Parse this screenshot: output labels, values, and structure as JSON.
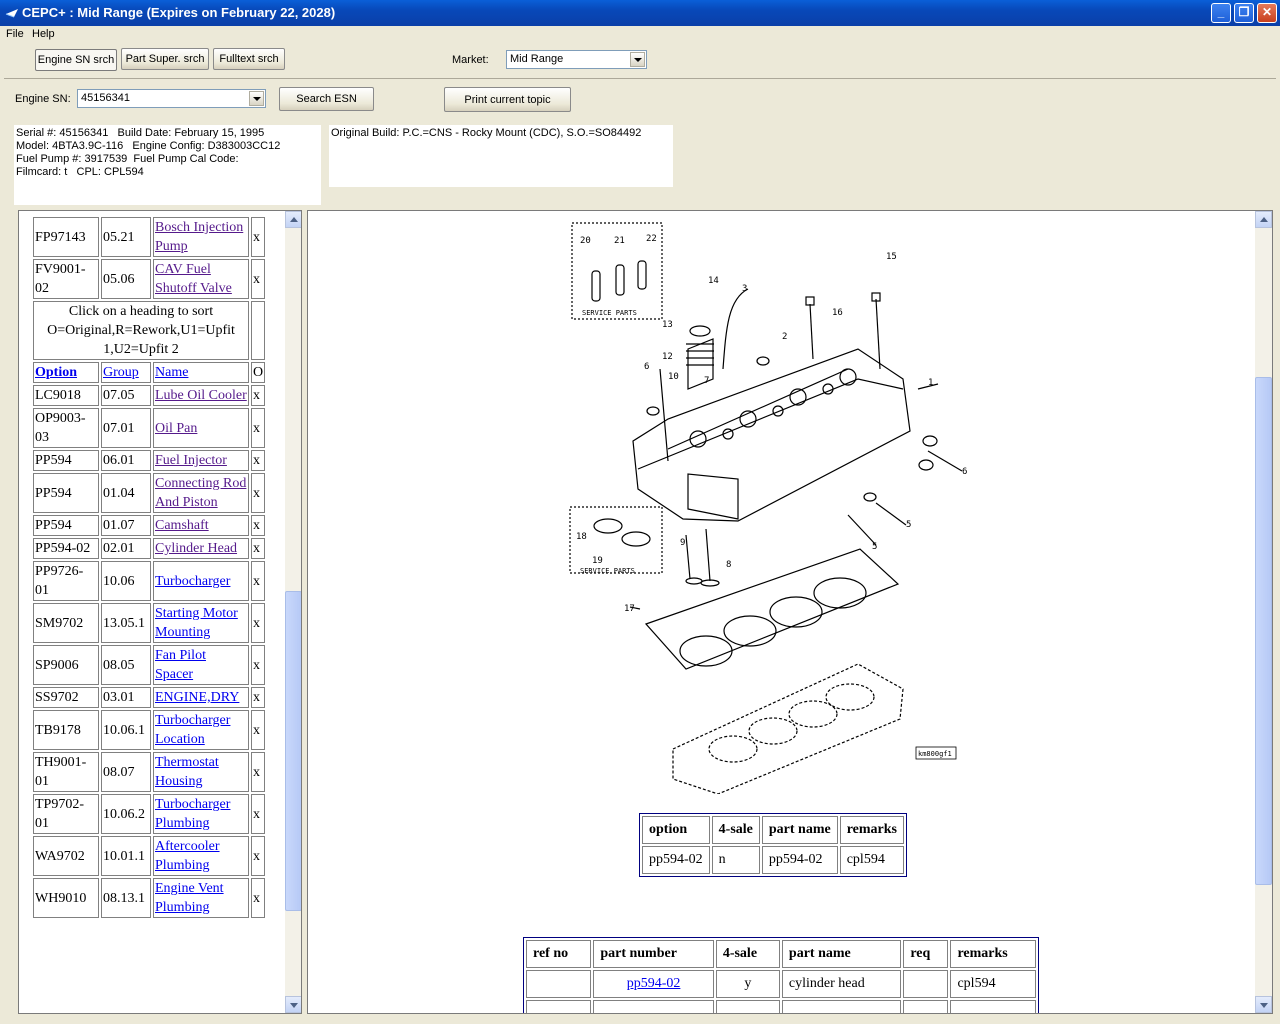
{
  "window": {
    "title": "CEPC+ : Mid Range (Expires on February 22, 2028)"
  },
  "menu": {
    "file": "File",
    "help": "Help"
  },
  "toolbar": {
    "tabs": [
      "Engine SN srch",
      "Part Super. srch",
      "Fulltext srch"
    ],
    "market_label": "Market:",
    "market_value": "Mid Range"
  },
  "search": {
    "esn_label": "Engine SN:",
    "esn_value": "45156341",
    "search_button": "Search ESN",
    "print_button": "Print current topic"
  },
  "engine_info": {
    "line1": "Serial #: 45156341   Build Date: February 15, 1995",
    "line2": "Model: 4BTA3.9C-116   Engine Config: D383003CC12",
    "line3": "Fuel Pump #: 3917539  Fuel Pump Cal Code:",
    "line4": "Filmcard: t   CPL: CPL594",
    "original_build": "Original Build: P.C.=CNS - Rocky Mount (CDC), S.O.=SO84492"
  },
  "options_top": [
    {
      "option": "FP97143",
      "group": "05.21",
      "name": "Bosch Injection Pump",
      "flag": "x",
      "visited": true
    },
    {
      "option": "FV9001-02",
      "group": "05.06",
      "name": "CAV Fuel Shutoff Valve",
      "flag": "x",
      "visited": true
    }
  ],
  "sort_note": "Click on a heading to sort O=Original,R=Rework,U1=Upfit 1,U2=Upfit 2",
  "options_headers": {
    "option": "Option",
    "group": "Group",
    "name": "Name",
    "o": "O"
  },
  "options": [
    {
      "option": "LC9018",
      "group": "07.05",
      "name": "Lube Oil Cooler",
      "flag": "x",
      "visited": true
    },
    {
      "option": "OP9003-03",
      "group": "07.01",
      "name": "Oil Pan",
      "flag": "x",
      "visited": true
    },
    {
      "option": "PP594",
      "group": "06.01",
      "name": "Fuel Injector",
      "flag": "x",
      "visited": true
    },
    {
      "option": "PP594",
      "group": "01.04",
      "name": "Connecting Rod And Piston",
      "flag": "x",
      "visited": true
    },
    {
      "option": "PP594",
      "group": "01.07",
      "name": "Camshaft",
      "flag": "x",
      "visited": true
    },
    {
      "option": "PP594-02",
      "group": "02.01",
      "name": "Cylinder Head",
      "flag": "x",
      "visited": true
    },
    {
      "option": "PP9726-01",
      "group": "10.06",
      "name": "Turbocharger",
      "flag": "x",
      "visited": false
    },
    {
      "option": "SM9702",
      "group": "13.05.1",
      "name": "Starting Motor Mounting",
      "flag": "x",
      "visited": false
    },
    {
      "option": "SP9006",
      "group": "08.05",
      "name": "Fan Pilot Spacer",
      "flag": "x",
      "visited": false
    },
    {
      "option": "SS9702",
      "group": "03.01",
      "name": "ENGINE,DRY",
      "flag": "x",
      "visited": false
    },
    {
      "option": "TB9178",
      "group": "10.06.1",
      "name": "Turbocharger Location",
      "flag": "x",
      "visited": false
    },
    {
      "option": "TH9001-01",
      "group": "08.07",
      "name": "Thermostat Housing",
      "flag": "x",
      "visited": false
    },
    {
      "option": "TP9702-01",
      "group": "10.06.2",
      "name": "Turbocharger Plumbing",
      "flag": "x",
      "visited": false
    },
    {
      "option": "WA9702",
      "group": "10.01.1",
      "name": "Aftercooler Plumbing",
      "flag": "x",
      "visited": false
    },
    {
      "option": "WH9010",
      "group": "08.13.1",
      "name": "Engine Vent Plumbing",
      "flag": "x",
      "visited": false
    }
  ],
  "diagram": {
    "callouts": [
      "20",
      "21",
      "22",
      "14",
      "3",
      "15",
      "16",
      "13",
      "2",
      "12",
      "10",
      "6",
      "1",
      "7",
      "5",
      "6",
      "5",
      "18",
      "19",
      "9",
      "8",
      "17"
    ],
    "service_parts": "SERVICE PARTS",
    "code": "km800gf1"
  },
  "option_table": {
    "headers": [
      "option",
      "4-sale",
      "part name",
      "remarks"
    ],
    "row": [
      "pp594-02",
      "n",
      "pp594-02",
      "cpl594"
    ]
  },
  "parts_table": {
    "headers": [
      "ref no",
      "part number",
      "4-sale",
      "part name",
      "req",
      "remarks"
    ],
    "row": [
      "",
      "pp594-02",
      "y",
      "cylinder head",
      "",
      "cpl594"
    ]
  }
}
